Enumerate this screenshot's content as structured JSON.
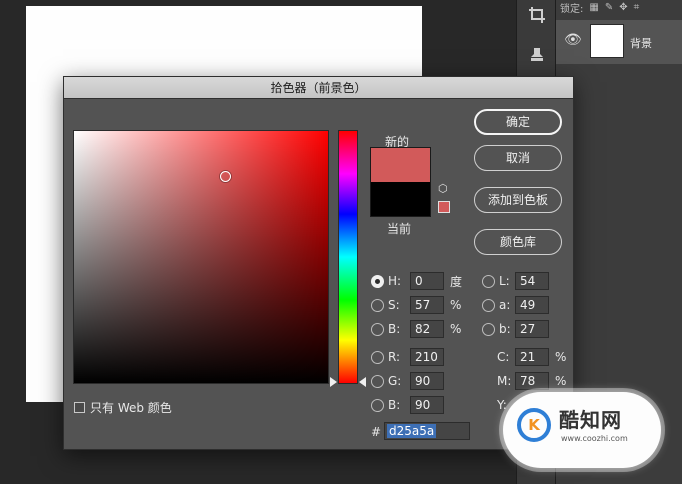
{
  "toolbar": {
    "tools": [
      {
        "icon": "crop-icon",
        "glyph": "⌗"
      },
      {
        "icon": "stamp-icon",
        "glyph": "♜"
      }
    ]
  },
  "layers": {
    "lock_label": "锁定:",
    "lock_icons": [
      "checker-lock-icon",
      "brush-lock-icon",
      "move-lock-icon",
      "artboard-lock-icon"
    ],
    "layer_name": "背景"
  },
  "dialog": {
    "title": "拾色器（前景色）",
    "new_label": "新的",
    "current_label": "当前",
    "new_color": "#d25a5a",
    "current_color": "#000000",
    "buttons": {
      "ok": "确定",
      "cancel": "取消",
      "add_swatch": "添加到色板",
      "color_library": "颜色库"
    },
    "hsb": {
      "h_label": "H:",
      "h_value": "0",
      "h_unit": "度",
      "s_label": "S:",
      "s_value": "57",
      "s_unit": "%",
      "b_label": "B:",
      "b_value": "82",
      "b_unit": "%"
    },
    "lab": {
      "l_label": "L:",
      "l_value": "54",
      "a_label": "a:",
      "a_value": "49",
      "b_label": "b:",
      "b_value": "27"
    },
    "rgb": {
      "r_label": "R:",
      "r_value": "210",
      "g_label": "G:",
      "g_value": "90",
      "b_label": "B:",
      "b_value": "90"
    },
    "cmyk": {
      "c_label": "C:",
      "c_value": "21",
      "c_unit": "%",
      "m_label": "M:",
      "m_value": "78",
      "m_unit": "%",
      "y_label": "Y:"
    },
    "hex_label": "#",
    "hex_value": "d25a5a",
    "web_only_label": "只有 Web 颜色"
  },
  "watermark": {
    "title": "酷知网",
    "url": "www.coozhi.com",
    "logo_text": "K"
  }
}
